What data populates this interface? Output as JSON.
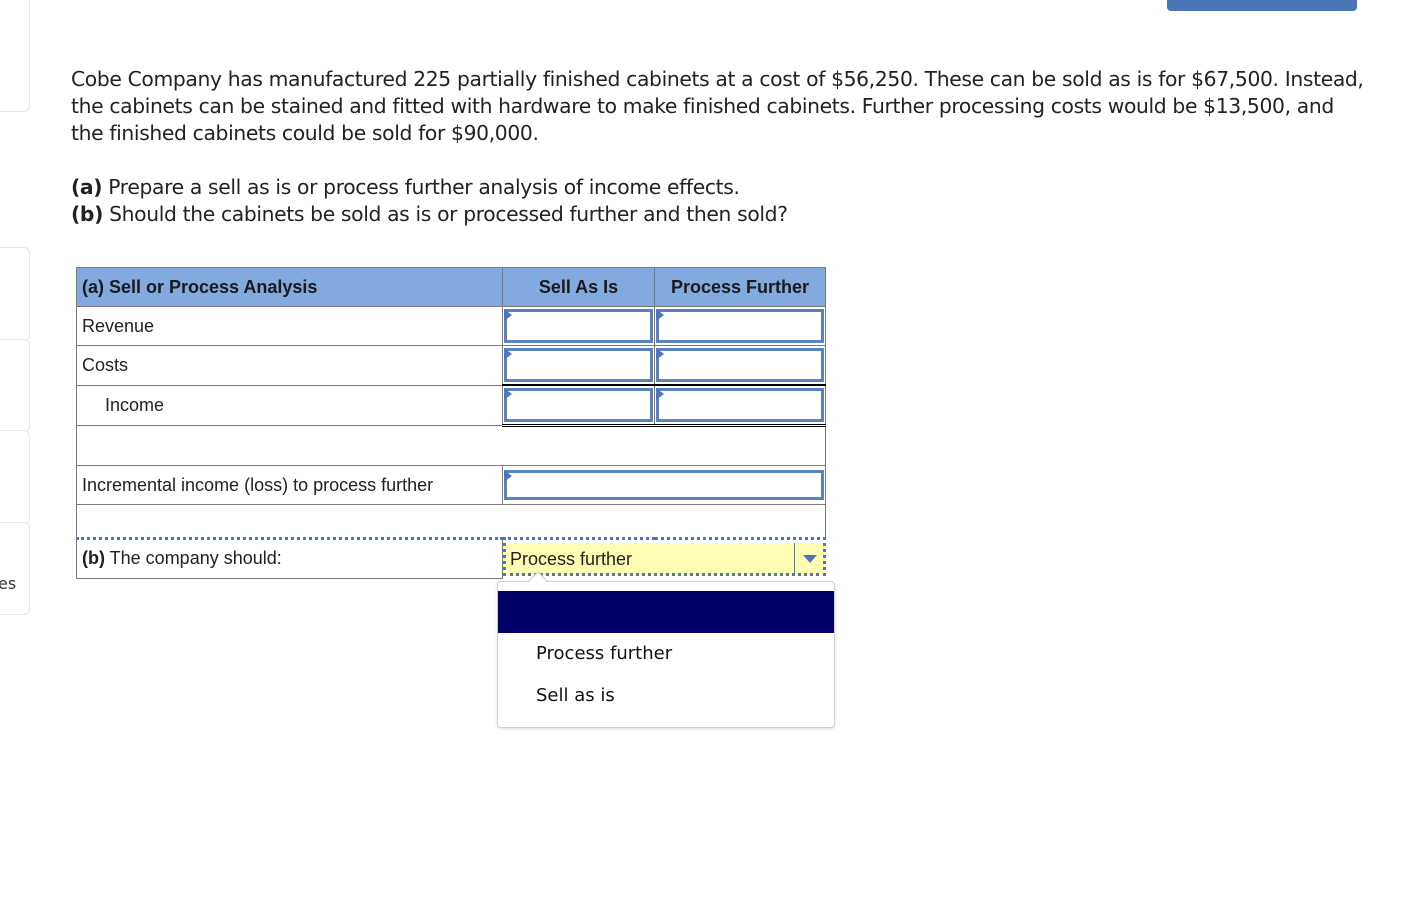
{
  "sidebar": {
    "partial_text": "es"
  },
  "problem": {
    "paragraph": "Cobe Company has manufactured 225 partially finished cabinets at a cost of $56,250. These can be sold as is for $67,500. Instead, the cabinets can be stained and fitted with hardware to make finished cabinets. Further processing costs would be $13,500, and the finished cabinets could be sold for $90,000.",
    "part_a_label": "(a)",
    "part_a_text": " Prepare a sell as is or process further analysis of income effects.",
    "part_b_label": "(b)",
    "part_b_text": " Should the cabinets be sold as is or processed further and then sold?"
  },
  "worksheet": {
    "header": {
      "title": "(a) Sell or Process Analysis",
      "col1": "Sell As Is",
      "col2": "Process Further"
    },
    "rows": [
      {
        "label": "Revenue",
        "sell_as_is": "",
        "process_further": ""
      },
      {
        "label": "Costs",
        "sell_as_is": "",
        "process_further": ""
      },
      {
        "label": "Income",
        "sell_as_is": "",
        "process_further": ""
      }
    ],
    "incremental": {
      "label": "Incremental income (loss) to process further",
      "value": ""
    },
    "part_b": {
      "label_bold": "(b)",
      "label_text": " The company should:",
      "selected": "Process further"
    }
  },
  "dropdown": {
    "options": [
      "",
      "Process further",
      "Sell as is"
    ],
    "highlighted_index": 0
  },
  "colors": {
    "header_bg": "#82aadf",
    "input_border": "#5a82be",
    "select_bg": "#fffcb4",
    "highlight": "#000066",
    "top_button": "#4a76b5"
  }
}
